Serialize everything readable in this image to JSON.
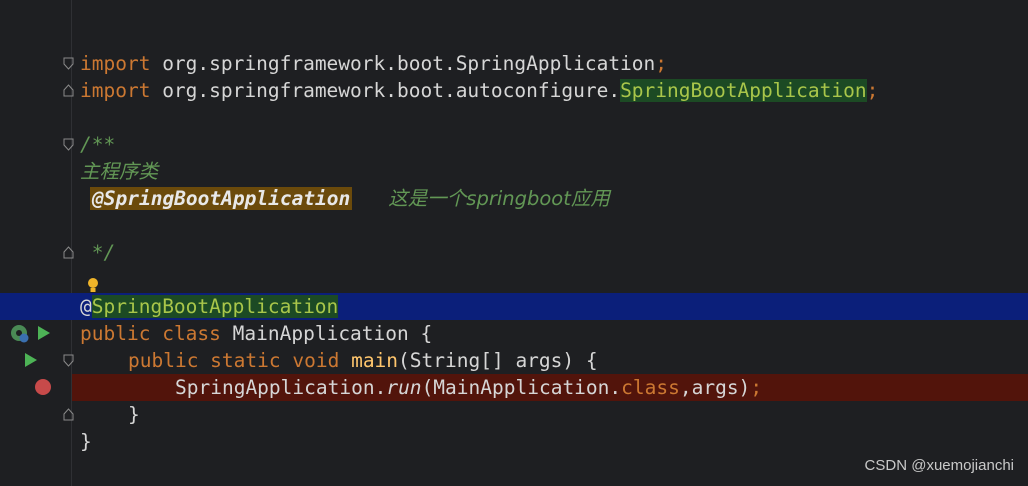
{
  "editor": {
    "lines": {
      "import1": {
        "kw": "import",
        "pkg": " org.springframework.boot.SpringApplication",
        "semi": ";"
      },
      "import2": {
        "kw": "import",
        "pkg": " org.springframework.boot.autoconfigure.",
        "cls": "SpringBootApplication",
        "semi": ";"
      },
      "doc_open": "/**",
      "doc_title": "主程序类",
      "doc_tag": "@SpringBootApplication",
      "doc_desc": "这是一个springboot应用",
      "doc_close": " */",
      "annotation": {
        "at": "@",
        "name": "SpringBootApplication"
      },
      "class_decl": {
        "public": "public",
        "class_kw": "class",
        "name": "MainApplication",
        "brace": "{"
      },
      "main_decl": {
        "modifiers": "public static void",
        "name": "main",
        "params": "(String[] args) {"
      },
      "run_call": {
        "receiver": "SpringApplication.",
        "method": "run",
        "arg_open": "(MainApplication.",
        "class_kw": "class",
        "args": ",args)",
        "semi": ";"
      },
      "close_inner": "}",
      "close_outer": "}"
    }
  },
  "gutter_icons": [
    "inspect-bean-icon",
    "run-spring-icon",
    "run-arrow-icon",
    "run-main-icon",
    "breakpoint-icon",
    "intention-bulb-icon"
  ],
  "watermark": "CSDN @xuemojianchi",
  "colors": {
    "background": "#1e1f22",
    "keyword": "#cc7832",
    "annotation_highlight": "#a9c64a",
    "comment": "#629755",
    "current_line": "#0b1f7a",
    "breakpoint_line": "#52140b",
    "breakpoint": "#c74a4a"
  }
}
